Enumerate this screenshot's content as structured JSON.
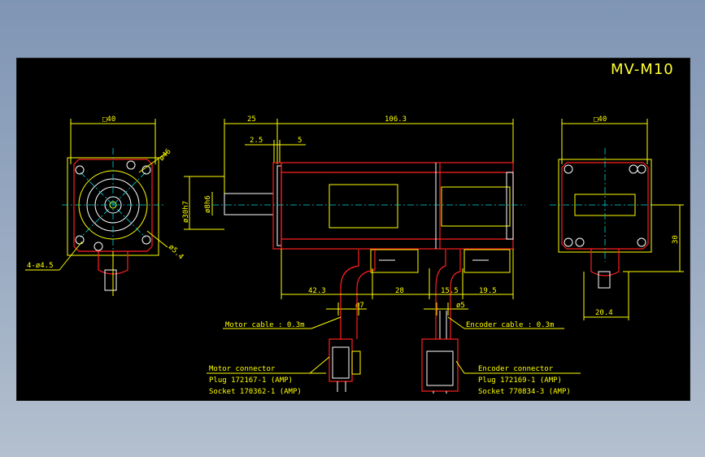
{
  "title": "MV-M10",
  "dims": {
    "front_square": "□40",
    "rear_square": "□40",
    "shaft_len": "25",
    "body_len": "106.3",
    "flange_a": "2.5",
    "flange_b": "5",
    "d46": "ø46",
    "d5_4": "ø5.4",
    "d30h7": "ø30h7",
    "d8h6": "ø8h6",
    "holes": "4-ø4.5",
    "b42_3": "42.3",
    "b28": "28",
    "b15_5": "15.5",
    "b19_5": "19.5",
    "motor_cable_d": "ø7",
    "encoder_cable_d": "ø5",
    "rear_30": "30",
    "rear_20_4": "20.4"
  },
  "labels": {
    "motor_cable": "Motor cable : 0.3m",
    "encoder_cable": "Encoder cable : 0.3m",
    "motor_connector": "Motor connector",
    "motor_plug": "Plug 172167-1 (AMP)",
    "motor_socket": "Socket 170362-1 (AMP)",
    "encoder_connector": "Encoder connector",
    "encoder_plug": "Plug 172169-1 (AMP)",
    "encoder_socket": "Socket 770834-3 (AMP)"
  }
}
